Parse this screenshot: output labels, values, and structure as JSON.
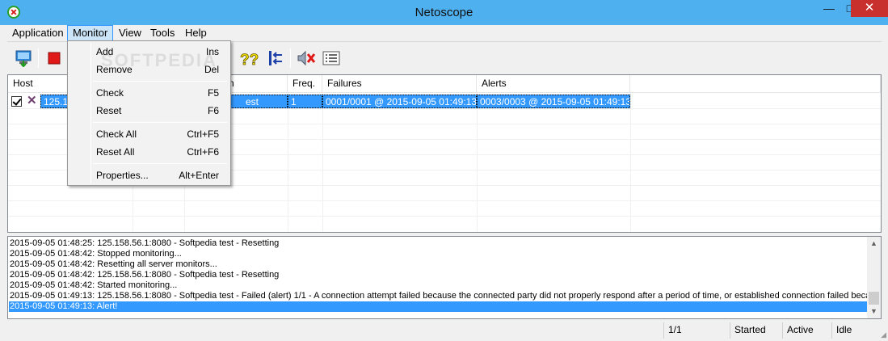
{
  "window": {
    "title": "Netoscope",
    "minimize": "—",
    "maximize": "□",
    "close": "✕"
  },
  "menubar": [
    "Application",
    "Monitor",
    "View",
    "Tools",
    "Help"
  ],
  "toolbar": {
    "buttons": [
      "add-monitor-icon",
      "stop-icon",
      "help-check-icon",
      "collapse-icon",
      "mute-alerts-icon",
      "details-list-icon"
    ]
  },
  "watermark": "SOFTPEDIA",
  "monitor_menu": {
    "items": [
      {
        "label": "Add",
        "shortcut": "Ins"
      },
      {
        "label": "Remove",
        "shortcut": "Del"
      },
      {
        "label": "Check",
        "shortcut": "F5"
      },
      {
        "label": "Reset",
        "shortcut": "F6"
      },
      {
        "label": "Check All",
        "shortcut": "Ctrl+F5"
      },
      {
        "label": "Reset All",
        "shortcut": "Ctrl+F6"
      },
      {
        "label": "Properties...",
        "shortcut": "Alt+Enter"
      }
    ]
  },
  "table": {
    "columns": [
      "Host",
      "n",
      "Freq.",
      "Failures",
      "Alerts"
    ],
    "rows": [
      {
        "checked": true,
        "host": "125.15",
        "description": "est",
        "freq": "1",
        "failures": "0001/0001 @ 2015-09-05 01:49:13",
        "alerts": "0003/0003 @ 2015-09-05 01:49:13"
      }
    ]
  },
  "log": [
    "2015-09-05 01:48:25: 125.158.56.1:8080 - Softpedia test - Resetting",
    "2015-09-05 01:48:42: Stopped monitoring...",
    "2015-09-05 01:48:42: Resetting all server monitors...",
    "2015-09-05 01:48:42: 125.158.56.1:8080 - Softpedia test - Resetting",
    "2015-09-05 01:48:42: Started monitoring...",
    "2015-09-05 01:49:13: 125.158.56.1:8080 - Softpedia test - Failed (alert) 1/1 - A connection attempt failed because the connected party did not properly respond after a period of time, or established connection failed because co",
    "2015-09-05 01:49:13: Alert!"
  ],
  "statusbar": {
    "count": "1/1",
    "state": "Started",
    "activity": "Active",
    "idle": "Idle"
  },
  "colors": {
    "titlebar": "#4fb0f0",
    "selection": "#3399ff",
    "close": "#c7302d"
  }
}
